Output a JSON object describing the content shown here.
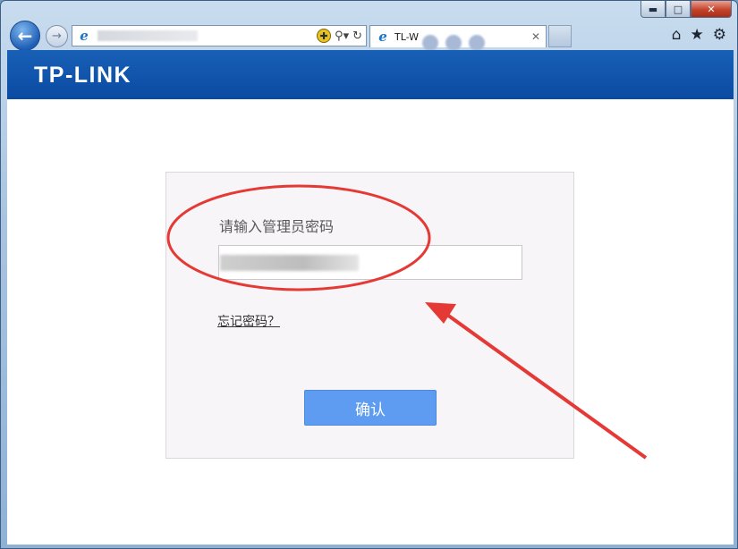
{
  "window": {
    "min_glyph": "▬",
    "max_glyph": "□",
    "close_glyph": "✕"
  },
  "nav": {
    "back_glyph": "←",
    "forward_glyph": "→"
  },
  "address": {
    "compat_glyph": "✚",
    "search_glyph": "⚲▾",
    "refresh_glyph": "↻"
  },
  "tab": {
    "title": "TL-W",
    "close_glyph": "✕"
  },
  "toolbar": {
    "home_glyph": "⌂",
    "favorites_glyph": "★",
    "tools_glyph": "⚙"
  },
  "brand": {
    "logo_text": "TP-LINK",
    "color": "#0f54a8"
  },
  "login": {
    "prompt": "请输入管理员密码",
    "password_value": "",
    "forgot_link": "忘记密码？",
    "confirm_label": "确认",
    "button_color": "#5e9cf2"
  },
  "annotation": {
    "color": "#e53935"
  }
}
